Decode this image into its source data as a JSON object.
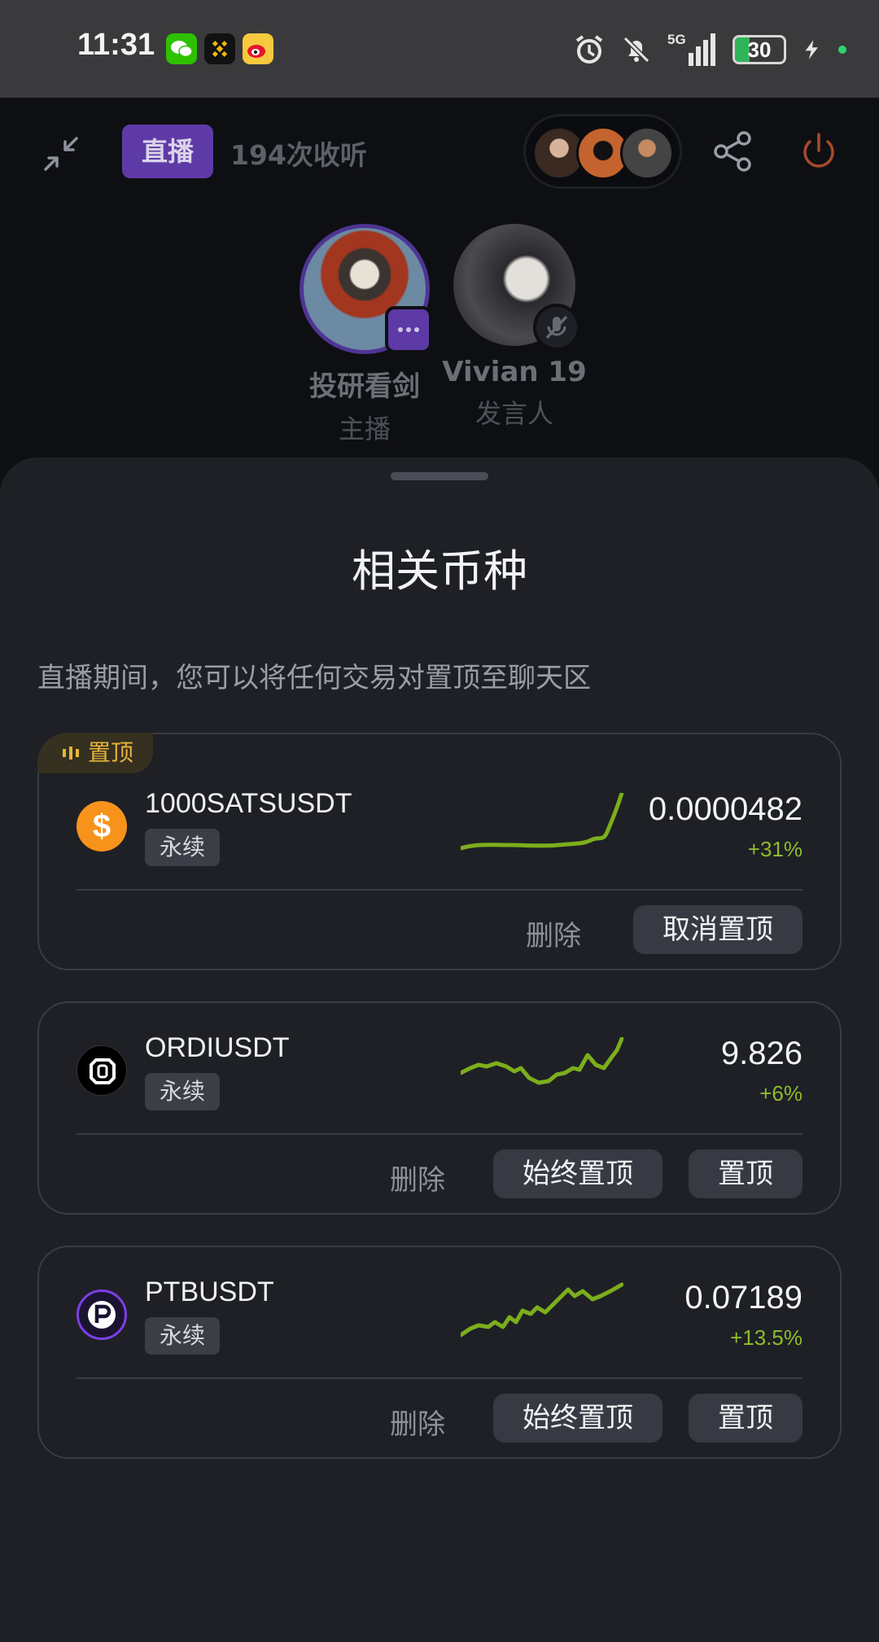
{
  "status_bar": {
    "time": "11:31",
    "battery": "30",
    "signal_label": "5G",
    "colors": {
      "wechat": "#2dc100",
      "binance": "#f0b90b",
      "weibo": "#f7c93e",
      "battery_fill": "#2fb45a"
    }
  },
  "live": {
    "badge": "直播",
    "listen_count": "194次收听",
    "speakers": [
      {
        "name": "投研看剑",
        "role": "主播"
      },
      {
        "name": "Vivian 19",
        "role": "发言人"
      }
    ]
  },
  "sheet": {
    "title": "相关币种",
    "description": "直播期间，您可以将任何交易对置顶至聊天区",
    "pinned_tag": "置顶",
    "cards": [
      {
        "symbol": "1000SATSUSDT",
        "tag": "永续",
        "price": "0.0000482",
        "change": "+31%",
        "delete": "删除",
        "action": "取消置顶",
        "pinned": true,
        "icon": "dollar-coin-icon",
        "icon_color": "#f7931a"
      },
      {
        "symbol": "ORDIUSDT",
        "tag": "永续",
        "price": "9.826",
        "change": "+6%",
        "delete": "删除",
        "always_pin": "始终置顶",
        "pin": "置顶",
        "pinned": false,
        "icon": "ordi-coin-icon",
        "icon_color": "#000000"
      },
      {
        "symbol": "PTBUSDT",
        "tag": "永续",
        "price": "0.07189",
        "change": "+13.5%",
        "delete": "删除",
        "always_pin": "始终置顶",
        "pin": "置顶",
        "pinned": false,
        "icon": "ptb-coin-icon",
        "icon_color": "#7b3fe4"
      }
    ],
    "accent_green": "#8ebc2a"
  }
}
